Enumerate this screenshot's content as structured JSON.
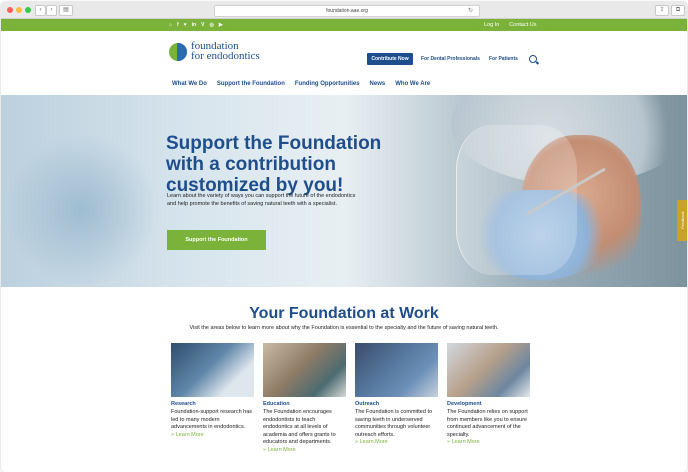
{
  "browser": {
    "url": "foundation.aae.org",
    "back": "‹",
    "forward": "›",
    "sidebar": "▤",
    "reload": "↻",
    "share": "⇪",
    "tabs": "⧉"
  },
  "topbar": {
    "social": [
      "⌂",
      "f",
      "♥",
      "in",
      "V",
      "◎",
      "▶"
    ],
    "login": "Log In",
    "contact": "Contact Us"
  },
  "header": {
    "logo_line1": "foundation",
    "logo_line2": "for endodontics",
    "contribute": "Contribute Now",
    "dental": "For Dental Professionals",
    "patients": "For Patients"
  },
  "nav": [
    "What We Do",
    "Support the Foundation",
    "Funding Opportunities",
    "News",
    "Who We Are"
  ],
  "hero": {
    "title": "Support the Foundation with a contribution customized by you!",
    "text": "Learn about the variety of ways you can support the future of the endodontics and help promote the benefits of saving natural teeth with a specialist.",
    "button": "Support the Foundation",
    "feedback": "Feedback"
  },
  "section": {
    "title": "Your Foundation at Work",
    "subtitle": "Visit the areas below to learn more about why the Foundation is essential to the specialty and the future of saving natural teeth."
  },
  "cards": [
    {
      "title": "Research",
      "text": "Foundation-support research has led to many modern advancements in endodontics.",
      "more": "» Learn More"
    },
    {
      "title": "Education",
      "text": "The Foundation encourages endodontists to teach endodontics at all levels of academia and offers grants to educators and departments.",
      "more": "» Learn More"
    },
    {
      "title": "Outreach",
      "text": "The Foundation is committed to saving teeth in underserved communities through volunteer outreach efforts.",
      "more": "» Learn More"
    },
    {
      "title": "Development",
      "text": "The Foundation relies on support from members like you to ensure continued advancement of the specialty.",
      "more": "» Learn More"
    }
  ],
  "colors": {
    "green": "#7bb33a",
    "blue": "#1e4e8c"
  }
}
